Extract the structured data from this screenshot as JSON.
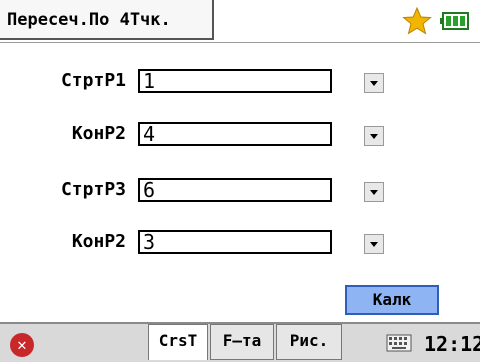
{
  "title": "Пересеч.По 4Тчк.",
  "rows": [
    {
      "label": "СтртР1",
      "value": "1"
    },
    {
      "label": "КонР2",
      "value": "4"
    },
    {
      "label": "СтртР3",
      "value": "6"
    },
    {
      "label": "КонР2",
      "value": "3"
    }
  ],
  "calc_label": "Калк",
  "tabs": [
    "CrsT",
    "F–та",
    "Рис."
  ],
  "clock": "12:12",
  "icons": {
    "status": "star-icon",
    "battery": "battery-icon",
    "close": "close-icon",
    "keyboard": "keyboard-icon"
  },
  "colors": {
    "calc_button": "#8fb4f4",
    "close": "#c8282a",
    "battery": "#2aa12a",
    "star": "#f2b600"
  }
}
